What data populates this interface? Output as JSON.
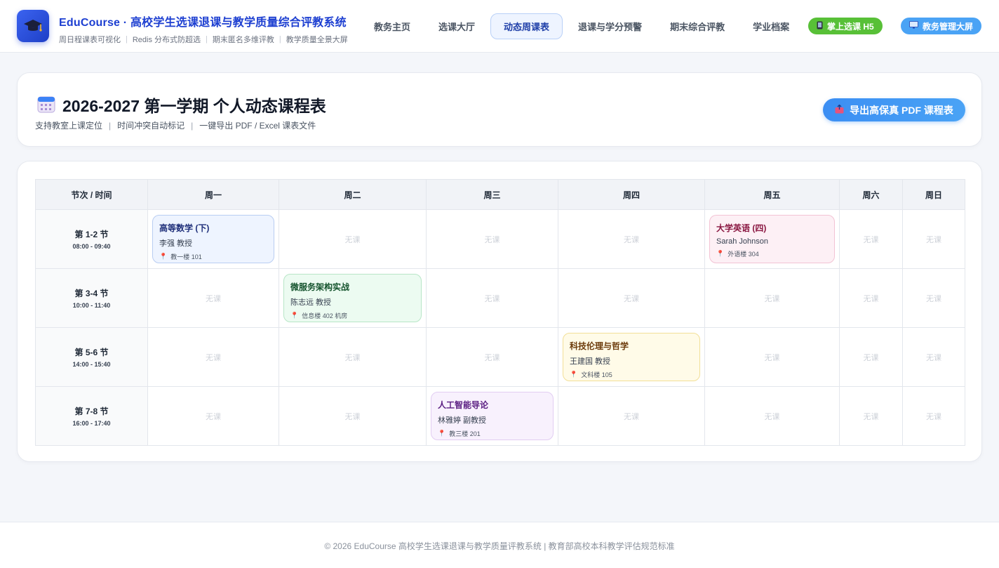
{
  "header": {
    "title": "EduCourse · 高校学生选课退课与教学质量综合评教系统",
    "subtitle_items": [
      "周日程课表可视化",
      "Redis 分布式防超选",
      "期末匿名多维评教",
      "教学质量全景大屏"
    ],
    "logo_icon": "graduation-cap-icon",
    "nav": [
      {
        "label": "教务主页",
        "active": false
      },
      {
        "label": "选课大厅",
        "active": false
      },
      {
        "label": "动态周课表",
        "active": true
      },
      {
        "label": "退课与学分预警",
        "active": false
      },
      {
        "label": "期末综合评教",
        "active": false
      },
      {
        "label": "学业档案",
        "active": false
      }
    ],
    "mobile_button": {
      "label": "掌上选课 H5",
      "icon": "mobile-phone-icon",
      "color": "#58c037"
    },
    "screen_button": {
      "label": "教务管理大屏",
      "icon": "monitor-icon",
      "color": "#4aa3f5"
    }
  },
  "page": {
    "title": "2026-2027 第一学期 个人动态课程表",
    "title_icon": "calendar-icon",
    "subtitle_items": [
      "支持教室上课定位",
      "时间冲突自动标记",
      "一键导出 PDF / Excel 课表文件"
    ],
    "export_button": {
      "label": "导出高保真 PDF 课程表",
      "icon": "export-icon"
    }
  },
  "schedule": {
    "corner_header": "节次 / 时间",
    "days": [
      "周一",
      "周二",
      "周三",
      "周四",
      "周五",
      "周六",
      "周日"
    ],
    "empty_label": "无课",
    "slots": [
      {
        "label": "第 1-2 节",
        "time": "08:00 - 09:40"
      },
      {
        "label": "第 3-4 节",
        "time": "10:00 - 11:40"
      },
      {
        "label": "第 5-6 节",
        "time": "14:00 - 15:40"
      },
      {
        "label": "第 7-8 节",
        "time": "16:00 - 17:40"
      }
    ],
    "courses": [
      {
        "slot": 0,
        "day": 0,
        "name": "高等数学 (下)",
        "teacher": "李强 教授",
        "room": "教一楼 101",
        "theme": "blue"
      },
      {
        "slot": 0,
        "day": 4,
        "name": "大学英语 (四)",
        "teacher": "Sarah Johnson",
        "room": "外语楼 304",
        "theme": "pink"
      },
      {
        "slot": 1,
        "day": 1,
        "name": "微服务架构实战",
        "teacher": "陈志远 教授",
        "room": "信息楼 402 机房",
        "theme": "green"
      },
      {
        "slot": 2,
        "day": 3,
        "name": "科技伦理与哲学",
        "teacher": "王建国 教授",
        "room": "文科楼 105",
        "theme": "yellow"
      },
      {
        "slot": 3,
        "day": 2,
        "name": "人工智能导论",
        "teacher": "林雅婷 副教授",
        "room": "教三楼 201",
        "theme": "purple"
      }
    ]
  },
  "footer": {
    "text": "© 2026 EduCourse 高校学生选课退课与教学质量评教系统 | 教育部高校本科教学评估规范标准"
  }
}
